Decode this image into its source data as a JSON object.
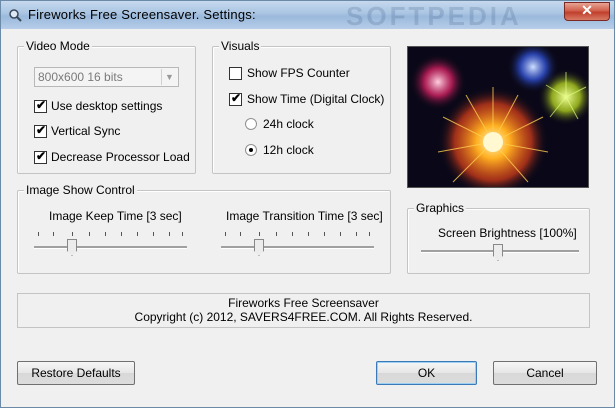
{
  "window": {
    "title": "Fireworks Free Screensaver. Settings:",
    "watermark": "SOFTPEDIA",
    "close_glyph": "✕"
  },
  "video_mode": {
    "group_label": "Video Mode",
    "resolution": "800x600 16 bits",
    "use_desktop_settings": {
      "label": "Use desktop settings",
      "checked": true
    },
    "vertical_sync": {
      "label": "Vertical Sync",
      "checked": true
    },
    "decrease_processor_load": {
      "label": "Decrease Processor Load",
      "checked": true
    }
  },
  "visuals": {
    "group_label": "Visuals",
    "show_fps_counter": {
      "label": "Show FPS Counter",
      "checked": false
    },
    "show_time": {
      "label": "Show Time (Digital Clock)",
      "checked": true
    },
    "clock_24h": {
      "label": "24h clock",
      "selected": false
    },
    "clock_12h": {
      "label": "12h clock",
      "selected": true
    }
  },
  "image_show_control": {
    "group_label": "Image Show Control",
    "keep_time": {
      "label": "Image Keep Time [3 sec]",
      "value_sec": 3
    },
    "transition_time": {
      "label": "Image Transition Time [3 sec]",
      "value_sec": 3
    }
  },
  "graphics": {
    "group_label": "Graphics",
    "brightness": {
      "label": "Screen Brightness [100%]",
      "value_percent": 100
    }
  },
  "info": {
    "line1": "Fireworks Free Screensaver",
    "line2": "Copyright (c) 2012, SAVERS4FREE.COM. All Rights Reserved."
  },
  "buttons": {
    "restore_defaults": "Restore Defaults",
    "ok": "OK",
    "cancel": "Cancel"
  },
  "icons": {
    "title": "magnifier-icon",
    "checkmark": "✔",
    "dropdown": "▼"
  }
}
